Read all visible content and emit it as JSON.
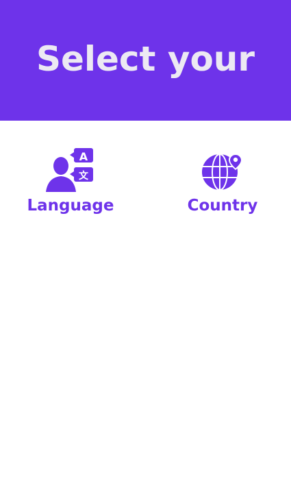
{
  "header": {
    "title": "Select your"
  },
  "options": [
    {
      "label": "Language",
      "icon": "language-person-icon"
    },
    {
      "label": "Country",
      "icon": "globe-location-icon"
    }
  ],
  "colors": {
    "accent": "#6e33ea",
    "header_text": "#ece9f3",
    "background": "#ffffff"
  }
}
